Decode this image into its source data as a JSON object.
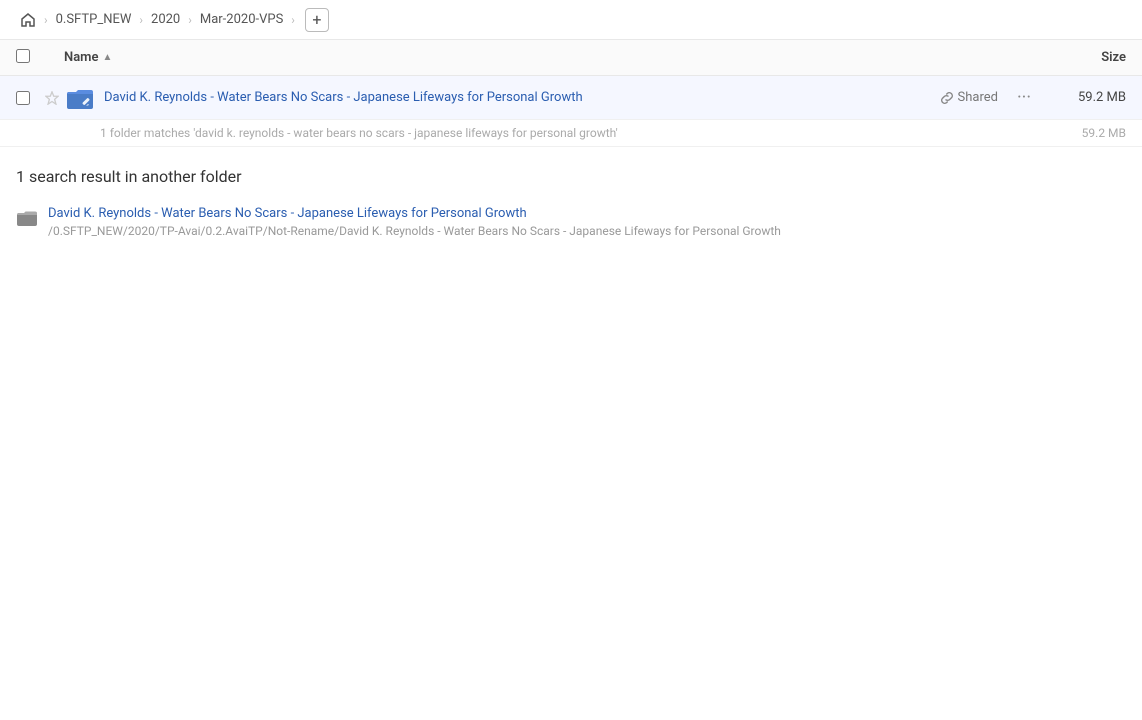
{
  "breadcrumb": {
    "home_label": "home",
    "items": [
      {
        "label": "0.SFTP_NEW"
      },
      {
        "label": "2020"
      },
      {
        "label": "Mar-2020-VPS"
      }
    ],
    "add_label": "+"
  },
  "column_header": {
    "name_label": "Name",
    "sort_indicator": "▲",
    "size_label": "Size"
  },
  "main_row": {
    "name": "David K. Reynolds - Water Bears No Scars - Japanese Lifeways for Personal Growth",
    "shared_label": "Shared",
    "size": "59.2 MB"
  },
  "matches_line": {
    "text": "1 folder matches 'david k. reynolds - water bears no scars - japanese lifeways for personal growth'",
    "size": "59.2 MB"
  },
  "another_folder_section": {
    "heading": "1 search result in another folder",
    "result": {
      "name": "David K. Reynolds - Water Bears No Scars - Japanese Lifeways for Personal Growth",
      "path": "/0.SFTP_NEW/2020/TP-Avai/0.2.AvaiTP/Not-Rename/David K. Reynolds - Water Bears No Scars - Japanese Lifeways for Personal Growth"
    }
  }
}
